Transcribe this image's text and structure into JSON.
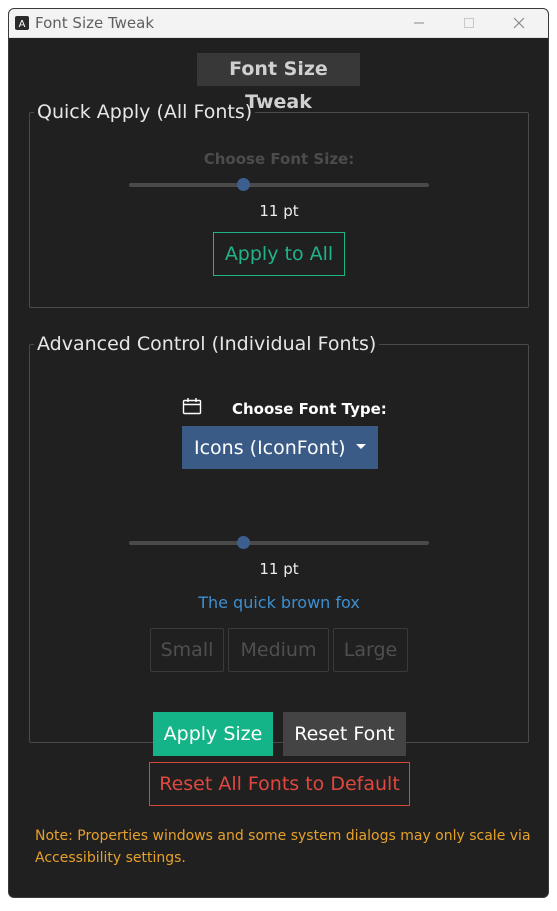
{
  "window": {
    "title": "Font Size Tweak"
  },
  "header": {
    "title": "Font Size Tweak"
  },
  "quick_apply": {
    "legend": "Quick Apply (All Fonts)",
    "label": "Choose Font Size:",
    "size_value": "11 pt",
    "slider_fraction": 0.38,
    "apply_label": "Apply to All"
  },
  "advanced": {
    "legend": "Advanced Control (Individual Fonts)",
    "font_type_label": "Choose Font Type:",
    "font_type_icon": "calendar-icon",
    "font_type_selected": "Icons (IconFont)",
    "size_value": "11 pt",
    "slider_fraction": 0.38,
    "sample_text": "The quick brown fox",
    "presets": [
      "Small",
      "Medium",
      "Large"
    ],
    "apply_label": "Apply Size",
    "reset_label": "Reset Font"
  },
  "footer": {
    "reset_all_label": "Reset All Fonts to Default",
    "note": "Note: Properties windows and some system dialogs may only scale via Accessibility settings."
  },
  "colors": {
    "background": "#202020",
    "accent_green": "#14b388",
    "accent_blue": "#3b5b87",
    "danger_red": "#e0483f",
    "note_orange": "#e6a12a",
    "sample_blue": "#3d8fd1"
  }
}
